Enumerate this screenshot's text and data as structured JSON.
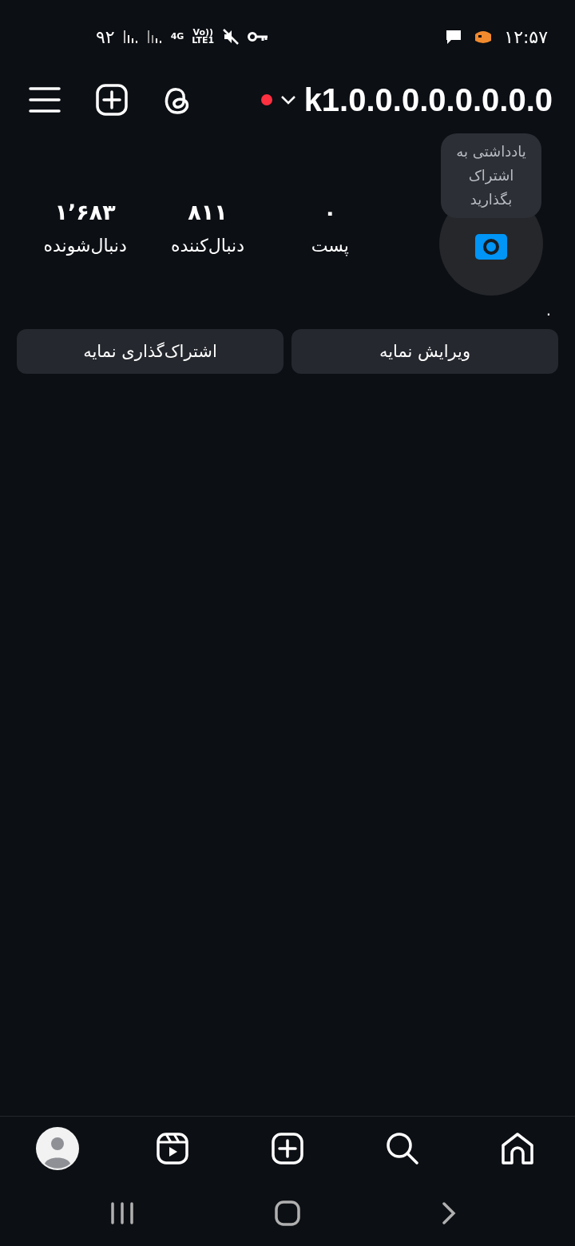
{
  "status_bar": {
    "time": "۱۲:۵۷",
    "battery": "۹۲",
    "network": "4G",
    "volte": "Vo))",
    "lte": "LTE1"
  },
  "header": {
    "username": "k1.0.0.0.0.0.0.0.0",
    "live_dot": true
  },
  "profile": {
    "note_bubble": "یادداشتی به اشتراک بگذارید",
    "bio": ".",
    "stats": [
      {
        "value": "۰",
        "label": "پست"
      },
      {
        "value": "۸۱۱",
        "label": "دنبال‌کننده"
      },
      {
        "value": "۱٬۶۸۳",
        "label": "دنبال‌شونده"
      }
    ]
  },
  "actions": [
    {
      "label": "ویرایش نمایه"
    },
    {
      "label": "اشتراک‌گذاری نمایه"
    }
  ],
  "bottom_nav": [
    {
      "kind": "home"
    },
    {
      "kind": "search"
    },
    {
      "kind": "create"
    },
    {
      "kind": "reels"
    },
    {
      "kind": "profile"
    }
  ]
}
